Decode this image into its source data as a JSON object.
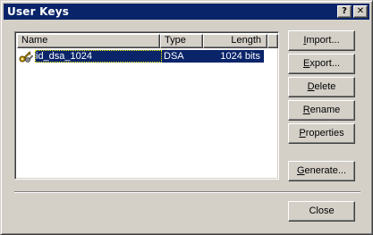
{
  "window": {
    "title": "User Keys",
    "help_glyph": "?",
    "close_glyph": "✕"
  },
  "list": {
    "columns": [
      "Name",
      "Type",
      "Length"
    ],
    "rows": [
      {
        "name": "id_dsa_1024",
        "type": "DSA",
        "length": "1024 bits",
        "icon": "key-pair-icon",
        "selected": true
      }
    ]
  },
  "buttons": {
    "import": {
      "accel": "I",
      "rest": "mport..."
    },
    "export": {
      "accel": "E",
      "rest": "xport..."
    },
    "delete": {
      "accel": "D",
      "rest": "elete"
    },
    "rename": {
      "accel": "R",
      "rest": "ename"
    },
    "properties": {
      "accel": "P",
      "rest": "roperties"
    },
    "generate": {
      "accel": "G",
      "rest": "enerate..."
    },
    "close": "Close"
  },
  "colors": {
    "face": "#d4d0c8",
    "titlebar": "#0a246a",
    "selection": "#0a246a"
  }
}
